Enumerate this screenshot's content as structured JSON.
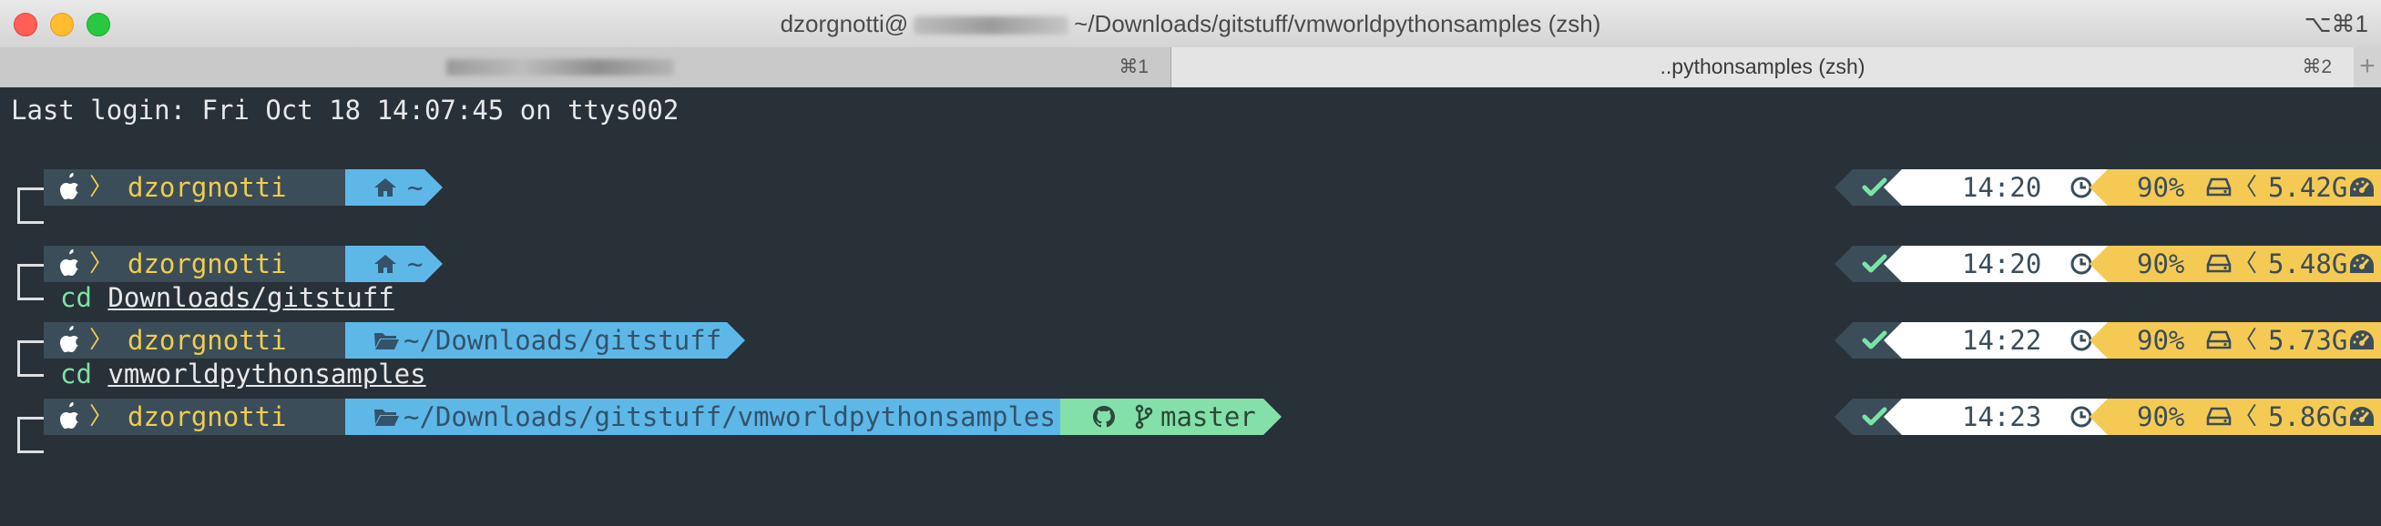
{
  "window": {
    "title_prefix": "dzorgnotti@",
    "title_suffix": "~/Downloads/gitstuff/vmworldpythonsamples (zsh)",
    "title_shortcut": "⌥⌘1"
  },
  "tabs": [
    {
      "label": "",
      "shortcut": "⌘1"
    },
    {
      "label": "..pythonsamples (zsh)",
      "shortcut": "⌘2"
    }
  ],
  "newtab_label": "+",
  "terminal": {
    "last_login": "Last login: Fri Oct 18 14:07:45 on ttys002",
    "prompt_icons": {
      "os": "apple-icon",
      "home": "home-icon",
      "folder": "folder-icon",
      "git": "github-icon",
      "branch": "branch-icon",
      "ok": "check-icon",
      "clock": "clock-icon",
      "disk": "disk-icon",
      "ram": "gauge-icon"
    },
    "prompts": [
      {
        "user": "dzorgnotti",
        "path": "~",
        "home": true,
        "git": null,
        "time": "14:20",
        "disk": "90%",
        "ram": "5.42G",
        "command": null
      },
      {
        "user": "dzorgnotti",
        "path": "~",
        "home": true,
        "git": null,
        "time": "14:20",
        "disk": "90%",
        "ram": "5.48G",
        "command": {
          "kw": "cd",
          "arg": "Downloads/gitstuff"
        }
      },
      {
        "user": "dzorgnotti",
        "path": "~/Downloads/gitstuff",
        "home": false,
        "git": null,
        "time": "14:22",
        "disk": "90%",
        "ram": "5.73G",
        "command": {
          "kw": "cd",
          "arg": "vmworldpythonsamples"
        }
      },
      {
        "user": "dzorgnotti",
        "path": "~/Downloads/gitstuff/vmworldpythonsamples",
        "home": false,
        "git": "master",
        "time": "14:23",
        "disk": "90%",
        "ram": "5.86G",
        "command": null
      }
    ]
  },
  "colors": {
    "background": "#283038",
    "segment_dark": "#3a4d59",
    "user_yellow": "#f0cc4f",
    "path_blue": "#5db8e8",
    "git_green": "#84e0a9",
    "time_white": "#ffffff",
    "stat_yellow": "#f5ca54",
    "check_green": "#7be3a5"
  }
}
